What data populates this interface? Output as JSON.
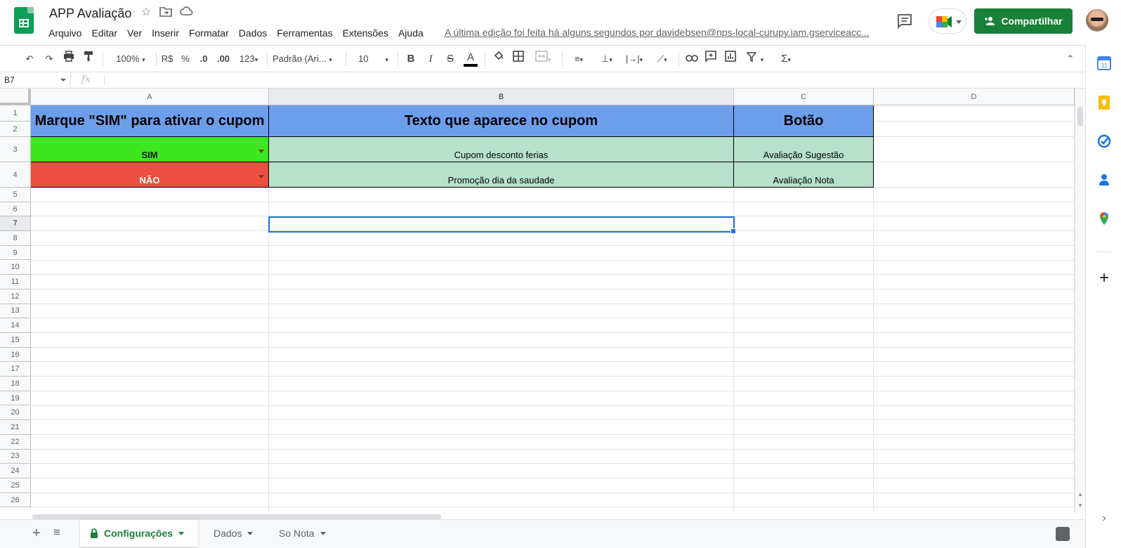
{
  "app": {
    "title": "APP Avaliação",
    "menu": [
      "Arquivo",
      "Editar",
      "Ver",
      "Inserir",
      "Formatar",
      "Dados",
      "Ferramentas",
      "Extensões",
      "Ajuda"
    ],
    "last_edit": "A última edição foi feita há alguns segundos por davidebsen@nps-local-curupy.iam.gserviceacc...",
    "share_label": "Compartilhar"
  },
  "toolbar": {
    "zoom": "100%",
    "currency": "R$",
    "percent": "%",
    "dec_decrease": ".0",
    "dec_increase": ".00",
    "more_formats": "123",
    "font": "Padrão (Ari...",
    "font_size": "10"
  },
  "formula_bar": {
    "cell_ref": "B7",
    "fx_label": "fx",
    "value": ""
  },
  "sheet": {
    "columns": [
      "A",
      "B",
      "C",
      "D"
    ],
    "selected_column": "B",
    "selected_row": 7,
    "rows": [
      "1",
      "2",
      "3",
      "4",
      "5",
      "6",
      "7",
      "8",
      "9",
      "10",
      "11",
      "12",
      "13",
      "14",
      "15",
      "16",
      "17",
      "18",
      "19",
      "20",
      "21",
      "22",
      "23",
      "24",
      "25",
      "26"
    ],
    "header": {
      "a": "Marque \"SIM\" para ativar o cupom",
      "b": "Texto que aparece no cupom",
      "c": "Botão"
    },
    "data": [
      {
        "a": "SIM",
        "b": "Cupom desconto ferias",
        "c": "Avaliação Sugestão"
      },
      {
        "a": "NÃO",
        "b": "Promoção dia da saudade",
        "c": "Avaliação Nota"
      }
    ]
  },
  "tabs": [
    {
      "label": "Configurações",
      "active": true,
      "locked": true
    },
    {
      "label": "Dados",
      "active": false
    },
    {
      "label": "So Nota",
      "active": false
    }
  ],
  "colors": {
    "header_fill": "#6d9eeb",
    "sim_fill": "#3de61f",
    "nao_fill": "#ea4f3f",
    "text_cell_fill": "#b7e1cd",
    "share_button": "#188038",
    "selection": "#1a73e8"
  }
}
